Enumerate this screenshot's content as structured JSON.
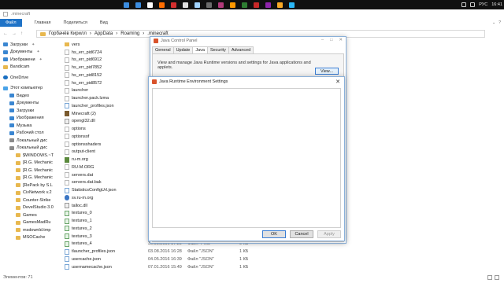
{
  "taskbar": {
    "language": "РУС",
    "time": "16:41",
    "app_colors": [
      "#3c8de0",
      "#3c8de0",
      "#ffffff",
      "#ff6d00",
      "#d32f2f",
      "#e0e0e0",
      "#a1d3ff",
      "#6b6b6b",
      "#b23a7b",
      "#ff9800",
      "#2e7d32",
      "#c62828",
      "#8e24aa",
      "#f9a825",
      "#29b6f6"
    ]
  },
  "window": {
    "title": ".minecraft"
  },
  "ribbon": {
    "tabs": [
      "Файл",
      "Главная",
      "Поделиться",
      "Вид"
    ]
  },
  "address": {
    "path": [
      "Горбачёв Кирилл",
      "AppData",
      "Roaming",
      ".minecraft"
    ]
  },
  "sidebar": {
    "items": [
      {
        "label": "Загрузки",
        "icon": "download-icon",
        "pinned": true
      },
      {
        "label": "Документы",
        "icon": "documents-icon",
        "pinned": true
      },
      {
        "label": "Изображени",
        "icon": "pictures-icon",
        "pinned": true
      },
      {
        "label": "Bandicam",
        "icon": "folder-icon",
        "pinned": false
      },
      {
        "label": "OneDrive",
        "icon": "onedrive-icon",
        "pinned": false
      },
      {
        "label": "Этот компьютер",
        "icon": "computer-icon",
        "pinned": false
      },
      {
        "label": "Видео",
        "icon": "video-icon",
        "pinned": false
      },
      {
        "label": "Документы",
        "icon": "documents-icon",
        "pinned": false
      },
      {
        "label": "Загрузки",
        "icon": "download-icon",
        "pinned": false
      },
      {
        "label": "Изображения",
        "icon": "pictures-icon",
        "pinned": false
      },
      {
        "label": "Музыка",
        "icon": "music-icon",
        "pinned": false
      },
      {
        "label": "Рабочий стол",
        "icon": "desktop-icon",
        "pinned": false
      },
      {
        "label": "Локальный дис",
        "icon": "drive-icon",
        "pinned": false
      },
      {
        "label": "Локальный дис",
        "icon": "drive-icon",
        "pinned": false
      },
      {
        "label": "$WINDOWS.~T",
        "icon": "folder-icon",
        "pinned": false
      },
      {
        "label": "[R.G. Mechanic",
        "icon": "folder-icon",
        "pinned": false
      },
      {
        "label": "[R.G. Mechanic",
        "icon": "folder-icon",
        "pinned": false
      },
      {
        "label": "[R.G. Mechanic",
        "icon": "folder-icon",
        "pinned": false
      },
      {
        "label": "[RePack by S.L",
        "icon": "folder-icon",
        "pinned": false
      },
      {
        "label": "CivNetwork v.2",
        "icon": "folder-icon",
        "pinned": false
      },
      {
        "label": "Counter-Strike",
        "icon": "folder-icon",
        "pinned": false
      },
      {
        "label": "DevelStudio 3.0",
        "icon": "folder-icon",
        "pinned": false
      },
      {
        "label": "Games",
        "icon": "folder-icon",
        "pinned": false
      },
      {
        "label": "GamesMadRu",
        "icon": "folder-icon",
        "pinned": false
      },
      {
        "label": "msdownld.tmp",
        "icon": "folder-icon",
        "pinned": false
      },
      {
        "label": "MSOCache",
        "icon": "folder-icon",
        "pinned": false
      }
    ]
  },
  "files": [
    {
      "name": "vers",
      "icon": "folder",
      "date": "",
      "type": "",
      "size": ""
    },
    {
      "name": "hs_err_pid6724",
      "icon": "doc",
      "date": "",
      "type": "",
      "size": ""
    },
    {
      "name": "hs_err_pid6912",
      "icon": "doc",
      "date": "",
      "type": "",
      "size": ""
    },
    {
      "name": "hs_err_pid7852",
      "icon": "doc",
      "date": "",
      "type": "",
      "size": ""
    },
    {
      "name": "hs_err_pid8152",
      "icon": "doc",
      "date": "",
      "type": "",
      "size": ""
    },
    {
      "name": "hs_err_pid8572",
      "icon": "doc",
      "date": "",
      "type": "",
      "size": ""
    },
    {
      "name": "launcher",
      "icon": "doc",
      "date": "",
      "type": "",
      "size": ""
    },
    {
      "name": "launcher.pack.lzma",
      "icon": "doc",
      "date": "",
      "type": "",
      "size": ""
    },
    {
      "name": "launcher_profiles.json",
      "icon": "json",
      "date": "",
      "type": "",
      "size": ""
    },
    {
      "name": "Minecraft (2)",
      "icon": "mc",
      "date": "",
      "type": "",
      "size": ""
    },
    {
      "name": "opengl32.dll",
      "icon": "dll",
      "date": "",
      "type": "",
      "size": ""
    },
    {
      "name": "options",
      "icon": "doc",
      "date": "",
      "type": "",
      "size": ""
    },
    {
      "name": "optionsof",
      "icon": "doc",
      "date": "",
      "type": "",
      "size": ""
    },
    {
      "name": "optionsshaders",
      "icon": "doc",
      "date": "",
      "type": "",
      "size": ""
    },
    {
      "name": "output-client",
      "icon": "doc",
      "date": "",
      "type": "",
      "size": ""
    },
    {
      "name": "ru-m.org",
      "icon": "app",
      "date": "",
      "type": "",
      "size": ""
    },
    {
      "name": "RU-M.ORG",
      "icon": "doc",
      "date": "",
      "type": "",
      "size": ""
    },
    {
      "name": "servers.dat",
      "icon": "doc",
      "date": "",
      "type": "",
      "size": ""
    },
    {
      "name": "servers.dat.bak",
      "icon": "doc",
      "date": "",
      "type": "",
      "size": ""
    },
    {
      "name": "StatisticsConfigUrl.json",
      "icon": "json",
      "date": "",
      "type": "",
      "size": ""
    },
    {
      "name": "sv.ru-m.org",
      "icon": "disk",
      "date": "",
      "type": "",
      "size": ""
    },
    {
      "name": "talloc.dll",
      "icon": "dll",
      "date": "",
      "type": "",
      "size": ""
    },
    {
      "name": "textures_0",
      "icon": "png",
      "date": "",
      "type": "",
      "size": ""
    },
    {
      "name": "textures_1",
      "icon": "png",
      "date": "",
      "type": "",
      "size": ""
    },
    {
      "name": "textures_2",
      "icon": "png",
      "date": "",
      "type": "",
      "size": ""
    },
    {
      "name": "textures_3",
      "icon": "png",
      "date": "",
      "type": "",
      "size": ""
    },
    {
      "name": "textures_4",
      "icon": "png",
      "date": "30.05.2016 17:29",
      "type": "Файл \"PNG\"",
      "size": "9 КБ"
    },
    {
      "name": "tlauncher_profiles.json",
      "icon": "json",
      "date": "03.08.2016 16:28",
      "type": "Файл \"JSON\"",
      "size": "1 КБ"
    },
    {
      "name": "usercache.json",
      "icon": "json",
      "date": "04.05.2016 16:39",
      "type": "Файл \"JSON\"",
      "size": "1 КБ"
    },
    {
      "name": "usernamecache.json",
      "icon": "json",
      "date": "07.01.2016 15:49",
      "type": "Файл \"JSON\"",
      "size": "1 КБ"
    }
  ],
  "status": {
    "text": "Элементов: 71"
  },
  "java_control_panel": {
    "title": "Java Control Panel",
    "tabs": [
      "General",
      "Update",
      "Java",
      "Security",
      "Advanced"
    ],
    "active_tab": "Java",
    "description": "View and manage Java Runtime versions and settings for Java applications and applets.",
    "view_button": "View..."
  },
  "jre_settings": {
    "title": "Java Runtime Environment Settings",
    "ok": "OK",
    "cancel": "Cancel",
    "apply": "Apply"
  }
}
